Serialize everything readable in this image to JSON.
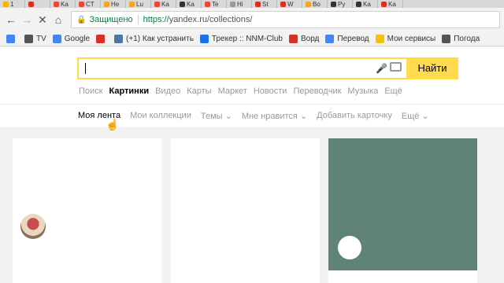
{
  "tabs": [
    {
      "label": "1",
      "color": "#f4b400"
    },
    {
      "label": "",
      "color": "#d93025"
    },
    {
      "label": "Ka",
      "color": "#e8453c"
    },
    {
      "label": "CT",
      "color": "#e8453c"
    },
    {
      "label": "He",
      "color": "#f4a623"
    },
    {
      "label": "Lu",
      "color": "#f4a623"
    },
    {
      "label": "Ka",
      "color": "#e8453c"
    },
    {
      "label": "Ka",
      "color": "#333333"
    },
    {
      "label": "Te",
      "color": "#e8453c"
    },
    {
      "label": "Hi",
      "color": "#999999"
    },
    {
      "label": "St",
      "color": "#d93025"
    },
    {
      "label": "W",
      "color": "#d93025"
    },
    {
      "label": "Bo",
      "color": "#f4a623"
    },
    {
      "label": "Py",
      "color": "#333333"
    },
    {
      "label": "Ka",
      "color": "#333333"
    },
    {
      "label": "Ka",
      "color": "#d93025"
    }
  ],
  "browser": {
    "secure_label": "Защищено",
    "url_proto": "https://",
    "url_rest": "yandex.ru/collections/"
  },
  "bookmarks": [
    {
      "label": "",
      "icon": "apps-icon",
      "color": "#4285f4"
    },
    {
      "label": "TV",
      "icon": "tv-icon",
      "color": "#555555"
    },
    {
      "label": "Google",
      "icon": "google-icon",
      "color": "#4285f4"
    },
    {
      "label": "",
      "icon": "s-icon",
      "color": "#d93025"
    },
    {
      "label": "(+1) Как устранить",
      "icon": "vk-icon",
      "color": "#4a76a8"
    },
    {
      "label": "Трекер :: NNM-Club",
      "icon": "nnm-icon",
      "color": "#1a73e8"
    },
    {
      "label": "Ворд",
      "icon": "word-icon",
      "color": "#d93025"
    },
    {
      "label": "Перевод",
      "icon": "translate-icon",
      "color": "#4285f4"
    },
    {
      "label": "Мои сервисы",
      "icon": "folder-icon",
      "color": "#f4c20d"
    },
    {
      "label": "Погода",
      "icon": "weather-icon",
      "color": "#555555"
    }
  ],
  "search": {
    "button_label": "Найти"
  },
  "services": [
    {
      "label": "Поиск",
      "active": false
    },
    {
      "label": "Картинки",
      "active": true
    },
    {
      "label": "Видео",
      "active": false
    },
    {
      "label": "Карты",
      "active": false
    },
    {
      "label": "Маркет",
      "active": false
    },
    {
      "label": "Новости",
      "active": false
    },
    {
      "label": "Переводчик",
      "active": false
    },
    {
      "label": "Музыка",
      "active": false
    },
    {
      "label": "Ещё",
      "active": false
    }
  ],
  "subnav": [
    {
      "label": "Моя лента",
      "active": true
    },
    {
      "label": "Мои коллекции",
      "active": false
    },
    {
      "label": "Темы ⌄",
      "active": false
    },
    {
      "label": "Мне нравится ⌄",
      "active": false
    },
    {
      "label": "Добавить карточку",
      "active": false
    },
    {
      "label": "Ещё ⌄",
      "active": false
    }
  ],
  "colors": {
    "accent": "#ffdb4d",
    "card_image": "#5f8475"
  }
}
